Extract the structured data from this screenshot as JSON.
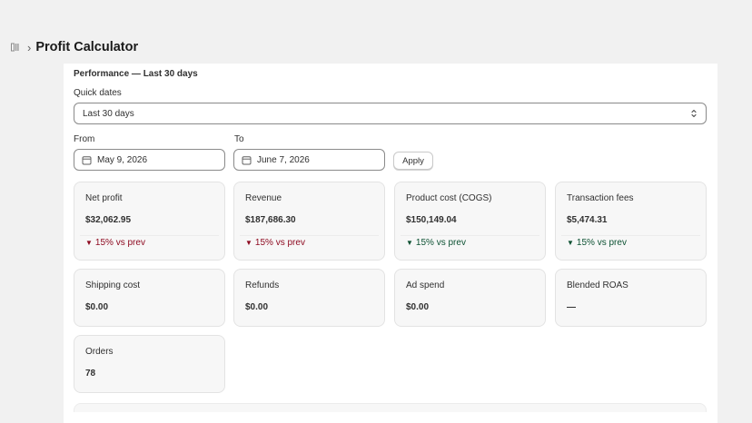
{
  "header": {
    "breadcrumb_icon": "apps-icon",
    "separator": "›",
    "title": "Profit Calculator"
  },
  "performance": {
    "title": "Performance — Last 30 days",
    "quick_dates_label": "Quick dates",
    "quick_dates_value": "Last 30 days",
    "from_label": "From",
    "from_value": "May 9, 2026",
    "to_label": "To",
    "to_value": "June 7, 2026",
    "apply_label": "Apply"
  },
  "colors": {
    "negative": "#8e0b21",
    "positive": "#0c5132"
  },
  "metrics": [
    {
      "label": "Net profit",
      "value": "$32,062.95",
      "change": "15% vs prev",
      "direction": "down"
    },
    {
      "label": "Revenue",
      "value": "$187,686.30",
      "change": "15% vs prev",
      "direction": "down"
    },
    {
      "label": "Product cost (COGS)",
      "value": "$150,149.04",
      "change": "15% vs prev",
      "direction": "down-good"
    },
    {
      "label": "Transaction fees",
      "value": "$5,474.31",
      "change": "15% vs prev",
      "direction": "down-good"
    },
    {
      "label": "Shipping cost",
      "value": "$0.00"
    },
    {
      "label": "Refunds",
      "value": "$0.00"
    },
    {
      "label": "Ad spend",
      "value": "$0.00"
    },
    {
      "label": "Blended ROAS",
      "value": "—"
    },
    {
      "label": "Orders",
      "value": "78"
    }
  ]
}
